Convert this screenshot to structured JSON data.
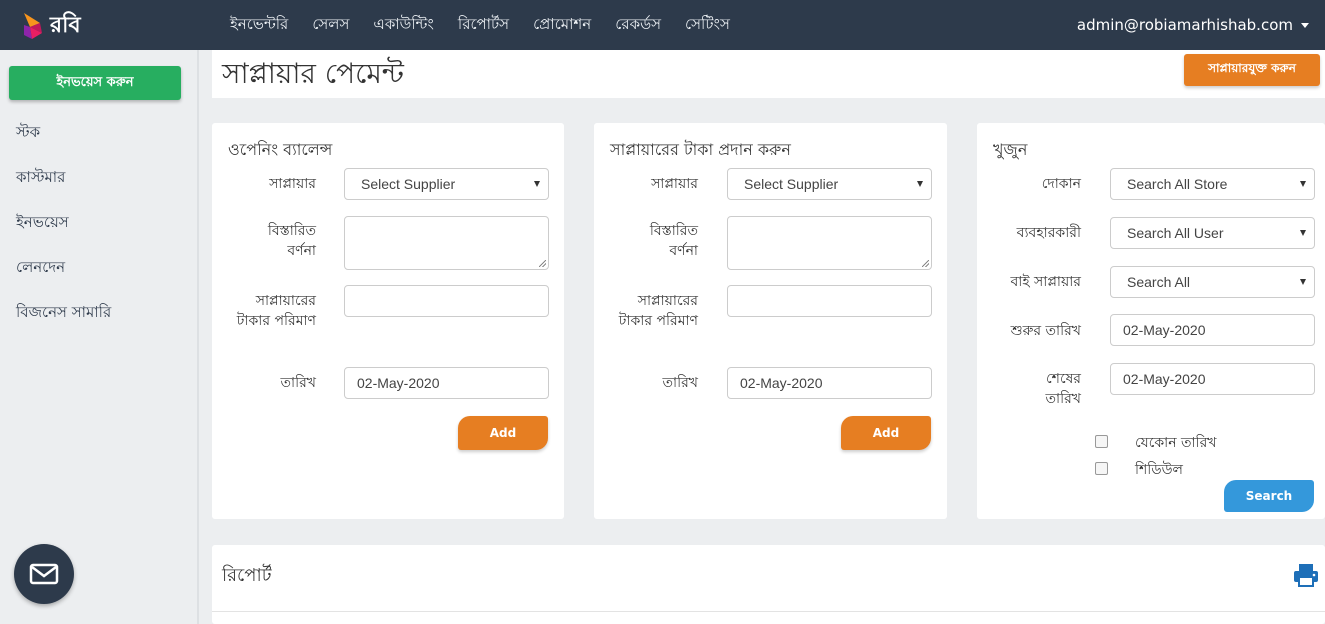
{
  "brand": {
    "name": "রবি"
  },
  "nav": {
    "items": [
      "ইনভেন্টরি",
      "সেলস",
      "একাউন্টিং",
      "রিপোর্টস",
      "প্রোমোশন",
      "রেকর্ডস",
      "সেটিংস"
    ],
    "user": "admin@robiamarhishab.com"
  },
  "sidebar": {
    "primary_button": "ইনভয়েস করুন",
    "items": [
      "স্টক",
      "কাস্টমার",
      "ইনভয়েস",
      "লেনদেন",
      "বিজনেস সামারি"
    ]
  },
  "header": {
    "title": "সাপ্লায়ার পেমেন্ট",
    "action_button": "সাপ্লায়ারযুক্ত করুন"
  },
  "opening_balance": {
    "title": "ওপেনিং ব্যালেন্স",
    "supplier_label": "সাপ্লায়ার",
    "supplier_value": "Select Supplier",
    "description_label": "বিস্তারিত বর্ণনা",
    "amount_label": "সাপ্লায়ারের টাকার পরিমাণ",
    "date_label": "তারিখ",
    "date_value": "02-May-2020",
    "add_button": "Add"
  },
  "pay_supplier": {
    "title": "সাপ্লায়ারের টাকা প্রদান করুন",
    "supplier_label": "সাপ্লায়ার",
    "supplier_value": "Select Supplier",
    "description_label": "বিস্তারিত বর্ণনা",
    "amount_label": "সাপ্লায়ারের টাকার পরিমাণ",
    "date_label": "তারিখ",
    "date_value": "02-May-2020",
    "add_button": "Add"
  },
  "search": {
    "title": "খুজুন",
    "store_label": "দোকান",
    "store_value": "Search All Store",
    "user_label": "ব্যবহারকারী",
    "user_value": "Search All User",
    "supplier_label": "বাই সাপ্লায়ার",
    "supplier_value": "Search All",
    "start_label": "শুরুর তারিখ",
    "start_value": "02-May-2020",
    "end_label": "শেষের তারিখ",
    "end_value": "02-May-2020",
    "any_date_label": "যেকোন তারিখ",
    "schedule_label": "শিডিউল",
    "search_button": "Search"
  },
  "report": {
    "title": "রিপোর্ট"
  },
  "colors": {
    "navbar": "#2d3a4b",
    "green": "#27ae60",
    "orange": "#e67e22",
    "blue": "#3498db"
  }
}
